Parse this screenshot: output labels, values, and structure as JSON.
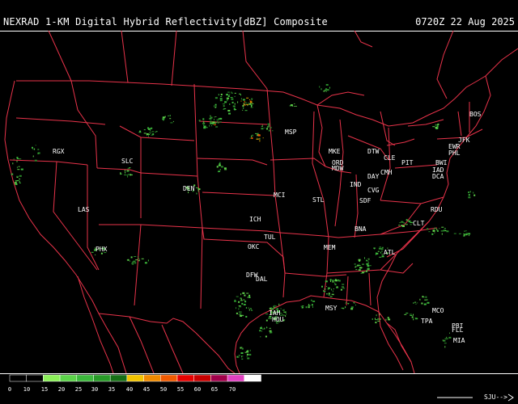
{
  "title": "NEXRAD 1-KM Digital Hybrid Reflectivity[dBZ] Composite",
  "timestamp": "0720Z 22 Aug 2025",
  "colors": {
    "background": "#000000",
    "borders": "#e8334a",
    "text": "#ffffff",
    "echo_light": "#5fd14a",
    "echo_mid": "#2a8c2a",
    "echo_heavy": "#d6a000"
  },
  "stations": [
    {
      "id": "RGX",
      "label": "RGX"
    },
    {
      "id": "SLC",
      "label": "SLC"
    },
    {
      "id": "LAS",
      "label": "LAS"
    },
    {
      "id": "PHX",
      "label": "PHX"
    },
    {
      "id": "DEN",
      "label": "DEN"
    },
    {
      "id": "MSP",
      "label": "MSP"
    },
    {
      "id": "MKE",
      "label": "MKE"
    },
    {
      "id": "ORD",
      "label": "ORD"
    },
    {
      "id": "MDW",
      "label": "MDW"
    },
    {
      "id": "DTW",
      "label": "DTW"
    },
    {
      "id": "CLE",
      "label": "CLE"
    },
    {
      "id": "PIT",
      "label": "PIT"
    },
    {
      "id": "BOS",
      "label": "BOS"
    },
    {
      "id": "JFK",
      "label": "JFK"
    },
    {
      "id": "EWR",
      "label": "EWR"
    },
    {
      "id": "PHL",
      "label": "PHL"
    },
    {
      "id": "BWI",
      "label": "BWI"
    },
    {
      "id": "IAD",
      "label": "IAD"
    },
    {
      "id": "DCA",
      "label": "DCA"
    },
    {
      "id": "DAY",
      "label": "DAY"
    },
    {
      "id": "CMH",
      "label": "CMH"
    },
    {
      "id": "IND",
      "label": "IND"
    },
    {
      "id": "CVG",
      "label": "CVG"
    },
    {
      "id": "SDF",
      "label": "SDF"
    },
    {
      "id": "STL",
      "label": "STL"
    },
    {
      "id": "MCI",
      "label": "MCI"
    },
    {
      "id": "ICH",
      "label": "ICH"
    },
    {
      "id": "TUL",
      "label": "TUL"
    },
    {
      "id": "OKC",
      "label": "OKC"
    },
    {
      "id": "DFW",
      "label": "DFW"
    },
    {
      "id": "DAL",
      "label": "DAL"
    },
    {
      "id": "IAH",
      "label": "IAH"
    },
    {
      "id": "HOU",
      "label": "HOU"
    },
    {
      "id": "MEM",
      "label": "MEM"
    },
    {
      "id": "BNA",
      "label": "BNA"
    },
    {
      "id": "ATL",
      "label": "ATL"
    },
    {
      "id": "CLT",
      "label": "CLT"
    },
    {
      "id": "RDU",
      "label": "RDU"
    },
    {
      "id": "MSY",
      "label": "MSY"
    },
    {
      "id": "MCO",
      "label": "MCO"
    },
    {
      "id": "TPA",
      "label": "TPA"
    },
    {
      "id": "FLL",
      "label": "FLL"
    },
    {
      "id": "PBI",
      "label": "PBI"
    },
    {
      "id": "MIA",
      "label": "MIA"
    }
  ],
  "legend": {
    "ticks": [
      "0",
      "10",
      "15",
      "20",
      "25",
      "30",
      "35",
      "40",
      "45",
      "50",
      "55",
      "60",
      "65",
      "70"
    ],
    "colors": [
      "#000000",
      "#000000",
      "#8cf05a",
      "#5cd34a",
      "#3cb83c",
      "#279a27",
      "#166f16",
      "#f2c400",
      "#f08a00",
      "#f05a00",
      "#e60000",
      "#c80000",
      "#a0004a",
      "#e040c0",
      "#ffffff"
    ],
    "credit": "SJU-->"
  }
}
